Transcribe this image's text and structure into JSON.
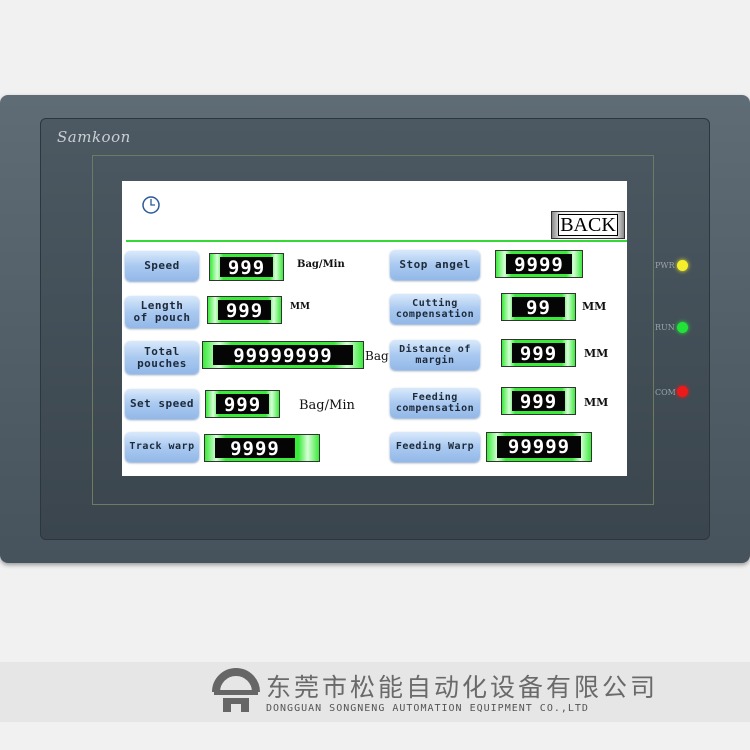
{
  "device": {
    "brand": "Samkoon",
    "leds": [
      {
        "label": "PWR",
        "color": "#f5ee2a"
      },
      {
        "label": "RUN",
        "color": "#22e23a"
      },
      {
        "label": "COM",
        "color": "#ee1a1a"
      }
    ]
  },
  "screen": {
    "clock_icon": "clock-icon",
    "back_label": "BACK",
    "accent_color": "#35d935",
    "left": [
      {
        "label": "Speed",
        "value": "999",
        "unit": "Bag/Min"
      },
      {
        "label": "Length\nof pouch",
        "value": "999",
        "unit": "MM"
      },
      {
        "label": "Total\npouches",
        "value": "99999999",
        "unit": "Bag"
      },
      {
        "label": "Set speed",
        "value": "999",
        "unit": "Bag/Min"
      },
      {
        "label": "Track warp",
        "value": "9999",
        "unit": ""
      }
    ],
    "right": [
      {
        "label": "Stop angel",
        "value": "9999",
        "unit": ""
      },
      {
        "label": "Cutting\ncompensation",
        "value": "99",
        "unit": "MM"
      },
      {
        "label": "Distance of\nmargin",
        "value": "999",
        "unit": "MM"
      },
      {
        "label": "Feeding\ncompensation",
        "value": "999",
        "unit": "MM"
      },
      {
        "label": "Feeding Warp",
        "value": "99999",
        "unit": ""
      }
    ]
  },
  "footer": {
    "company_cn": "东莞市松能自动化设备有限公司",
    "company_en": "DONGGUAN SONGNENG AUTOMATION EQUIPMENT CO.,LTD"
  }
}
